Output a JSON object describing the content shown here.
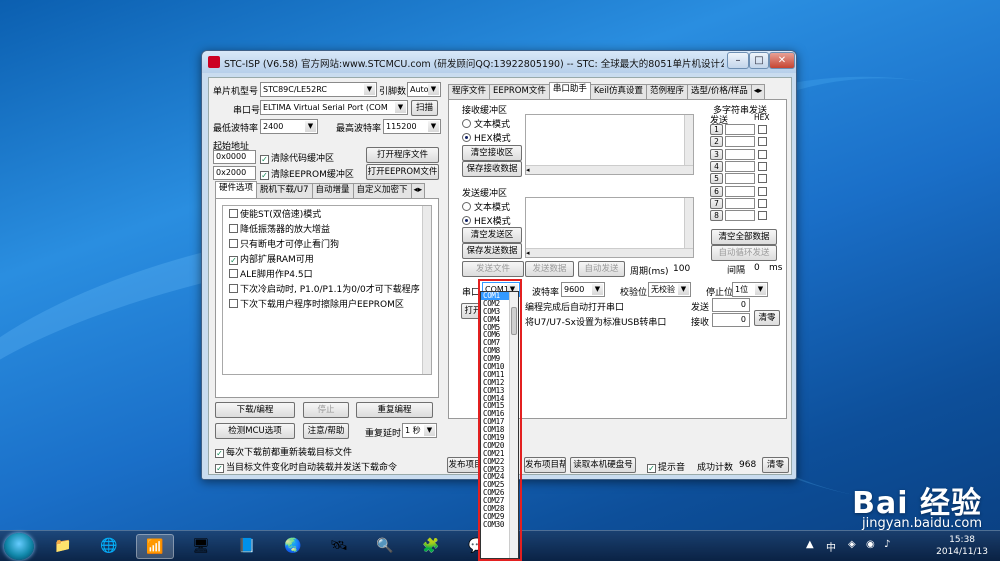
{
  "window": {
    "title": "STC-ISP (V6.58) 官方网站:www.STCMCU.com  (研发顾问QQ:13922805190)  -- STC: 全球最大的8051单片机设计公司 (就...",
    "min_label": "–",
    "max_label": "□",
    "close_label": "✕"
  },
  "left": {
    "mcu_label": "单片机型号",
    "mcu_value": "STC89C/LE52RC",
    "pins_label": "引脚数",
    "pins_value": "Auto",
    "port_label": "串口号",
    "port_value": "ELTIMA Virtual Serial Port (COM",
    "scan_label": "扫描",
    "min_baud_label": "最低波特率",
    "min_baud_value": "2400",
    "max_baud_label": "最高波特率",
    "max_baud_value": "115200",
    "start_addr_label": "起始地址",
    "addr1": "0x0000",
    "clear_code_label": "清除代码缓冲区",
    "open_program_label": "打开程序文件",
    "addr2": "0x2000",
    "clear_eeprom_label": "清除EEPROM缓冲区",
    "open_eeprom_label": "打开EEPROM文件",
    "tabs": [
      "硬件选项",
      "脱机下载/U7",
      "自动增量",
      "自定义加密下"
    ],
    "options": [
      {
        "label": "使能ST(双倍速)模式",
        "checked": false
      },
      {
        "label": "降低振荡器的放大增益",
        "checked": false
      },
      {
        "label": "只有断电才可停止看门狗",
        "checked": false
      },
      {
        "label": "内部扩展RAM可用",
        "checked": true
      },
      {
        "label": "ALE脚用作P4.5口",
        "checked": false
      },
      {
        "label": "下次冷启动时, P1.0/P1.1为0/0才可下载程序",
        "checked": false
      },
      {
        "label": "下次下载用户程序时擦除用户EEPROM区",
        "checked": false
      }
    ],
    "download_label": "下载/编程",
    "stop_label": "停止",
    "reprogram_label": "重复编程",
    "check_mcu_label": "检测MCU选项",
    "help_label": "注意/帮助",
    "retry_delay_label": "重复延时",
    "retry_delay_value": "1 秒",
    "reload_each_label": "每次下载前都重新装载目标文件",
    "auto_reload_label": "当目标文件变化时自动装载并发送下载命令"
  },
  "right": {
    "tabs": [
      "程序文件",
      "EEPROM文件",
      "串口助手",
      "Keil仿真设置",
      "范例程序",
      "选型/价格/样品"
    ],
    "recv_title": "接收缓冲区",
    "text_mode": "文本模式",
    "hex_mode": "HEX模式",
    "clear_recv": "清空接收区",
    "save_recv": "保存接收数据",
    "send_title": "发送缓冲区",
    "clear_send": "清空发送区",
    "save_send": "保存发送数据",
    "send_file": "发送文件",
    "send_data": "发送数据",
    "auto_send": "自动发送",
    "period_label": "周期(ms)",
    "period_value": "100",
    "multi_title": "多字符串发送",
    "send_col": "发送",
    "hex_col": "HEX",
    "multi_rows": [
      "1",
      "2",
      "3",
      "4",
      "5",
      "6",
      "7",
      "8"
    ],
    "clear_all": "清空全部数据",
    "auto_loop": "自动循环发送",
    "interval_label": "间隔",
    "interval_value": "0",
    "interval_unit": "ms",
    "port_label": "串口",
    "port_value": "COM1",
    "baud_label": "波特率",
    "baud_value": "9600",
    "parity_label": "校验位",
    "parity_value": "无校验",
    "stop_label": "停止位",
    "stop_value": "1位",
    "open_btn_label": "打开",
    "auto_open_label": "编程完成后自动打开串口",
    "usb_label": "将U7/U7-Sx设置为标准USB转串口",
    "sent_label": "发送",
    "sent_value": "0",
    "recv_label": "接收",
    "recv_value": "0",
    "clear_count": "清零",
    "publish_label": "发布项目",
    "publish_help_label": "发布项目帮助",
    "read_disk_label": "读取本机硬盘号",
    "beep_label": "提示音",
    "success_label": "成功计数",
    "success_value": "968",
    "clear2": "清零"
  },
  "dropdown": {
    "items": [
      "COM1",
      "COM2",
      "COM3",
      "COM4",
      "COM5",
      "COM6",
      "COM7",
      "COM8",
      "COM9",
      "COM10",
      "COM11",
      "COM12",
      "COM13",
      "COM14",
      "COM15",
      "COM16",
      "COM17",
      "COM18",
      "COM19",
      "COM20",
      "COM21",
      "COM22",
      "COM23",
      "COM24",
      "COM25",
      "COM26",
      "COM27",
      "COM28",
      "COM29",
      "COM30"
    ],
    "highlight_color": "#3399ff"
  },
  "taskbar": {
    "ime": "中",
    "time": "15:38",
    "date": "2014/11/13"
  },
  "watermark": {
    "brand": "Bai 经验",
    "url": "jingyan.baidu.com"
  }
}
